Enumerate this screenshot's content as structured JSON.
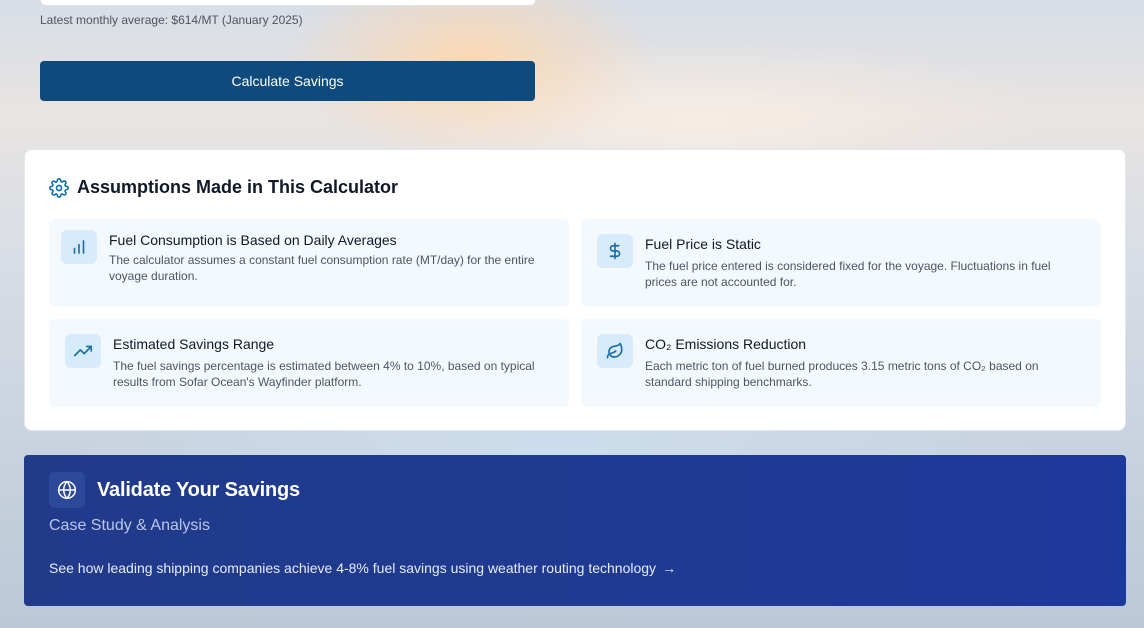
{
  "form": {
    "fuel_price_hint": "Latest monthly average: $614/MT (January 2025)",
    "calculate_label": "Calculate Savings"
  },
  "assumptions": {
    "title": "Assumptions Made in This Calculator",
    "header_icon": "gear-icon",
    "items": [
      {
        "icon": "bar-chart-icon",
        "title": "Fuel Consumption is Based on Daily Averages",
        "description": "The calculator assumes a constant fuel consumption rate (MT/day) for the entire voyage duration."
      },
      {
        "icon": "dollar-icon",
        "title": "Fuel Price is Static",
        "description": "The fuel price entered is considered fixed for the voyage. Fluctuations in fuel prices are not accounted for."
      },
      {
        "icon": "trending-up-icon",
        "title": "Estimated Savings Range",
        "description": "The fuel savings percentage is estimated between 4% to 10%, based on typical results from Sofar Ocean's Wayfinder platform."
      },
      {
        "icon": "leaf-icon",
        "title": "CO₂ Emissions Reduction",
        "description": "Each metric ton of fuel burned produces 3.15 metric tons of CO₂ based on standard shipping benchmarks."
      }
    ]
  },
  "validate": {
    "icon": "globe-icon",
    "title": "Validate Your Savings",
    "subtitle": "Case Study & Analysis",
    "link_text": "See how leading shipping companies achieve 4-8% fuel savings using weather routing technology",
    "link_arrow": "→"
  },
  "colors": {
    "primary_button": "#0e4a7b",
    "accent_icon": "#1a6fa8",
    "card_bg": "#f4f9fe",
    "icon_bg": "#d6ebfb",
    "validate_bg": "#1f3a92"
  }
}
